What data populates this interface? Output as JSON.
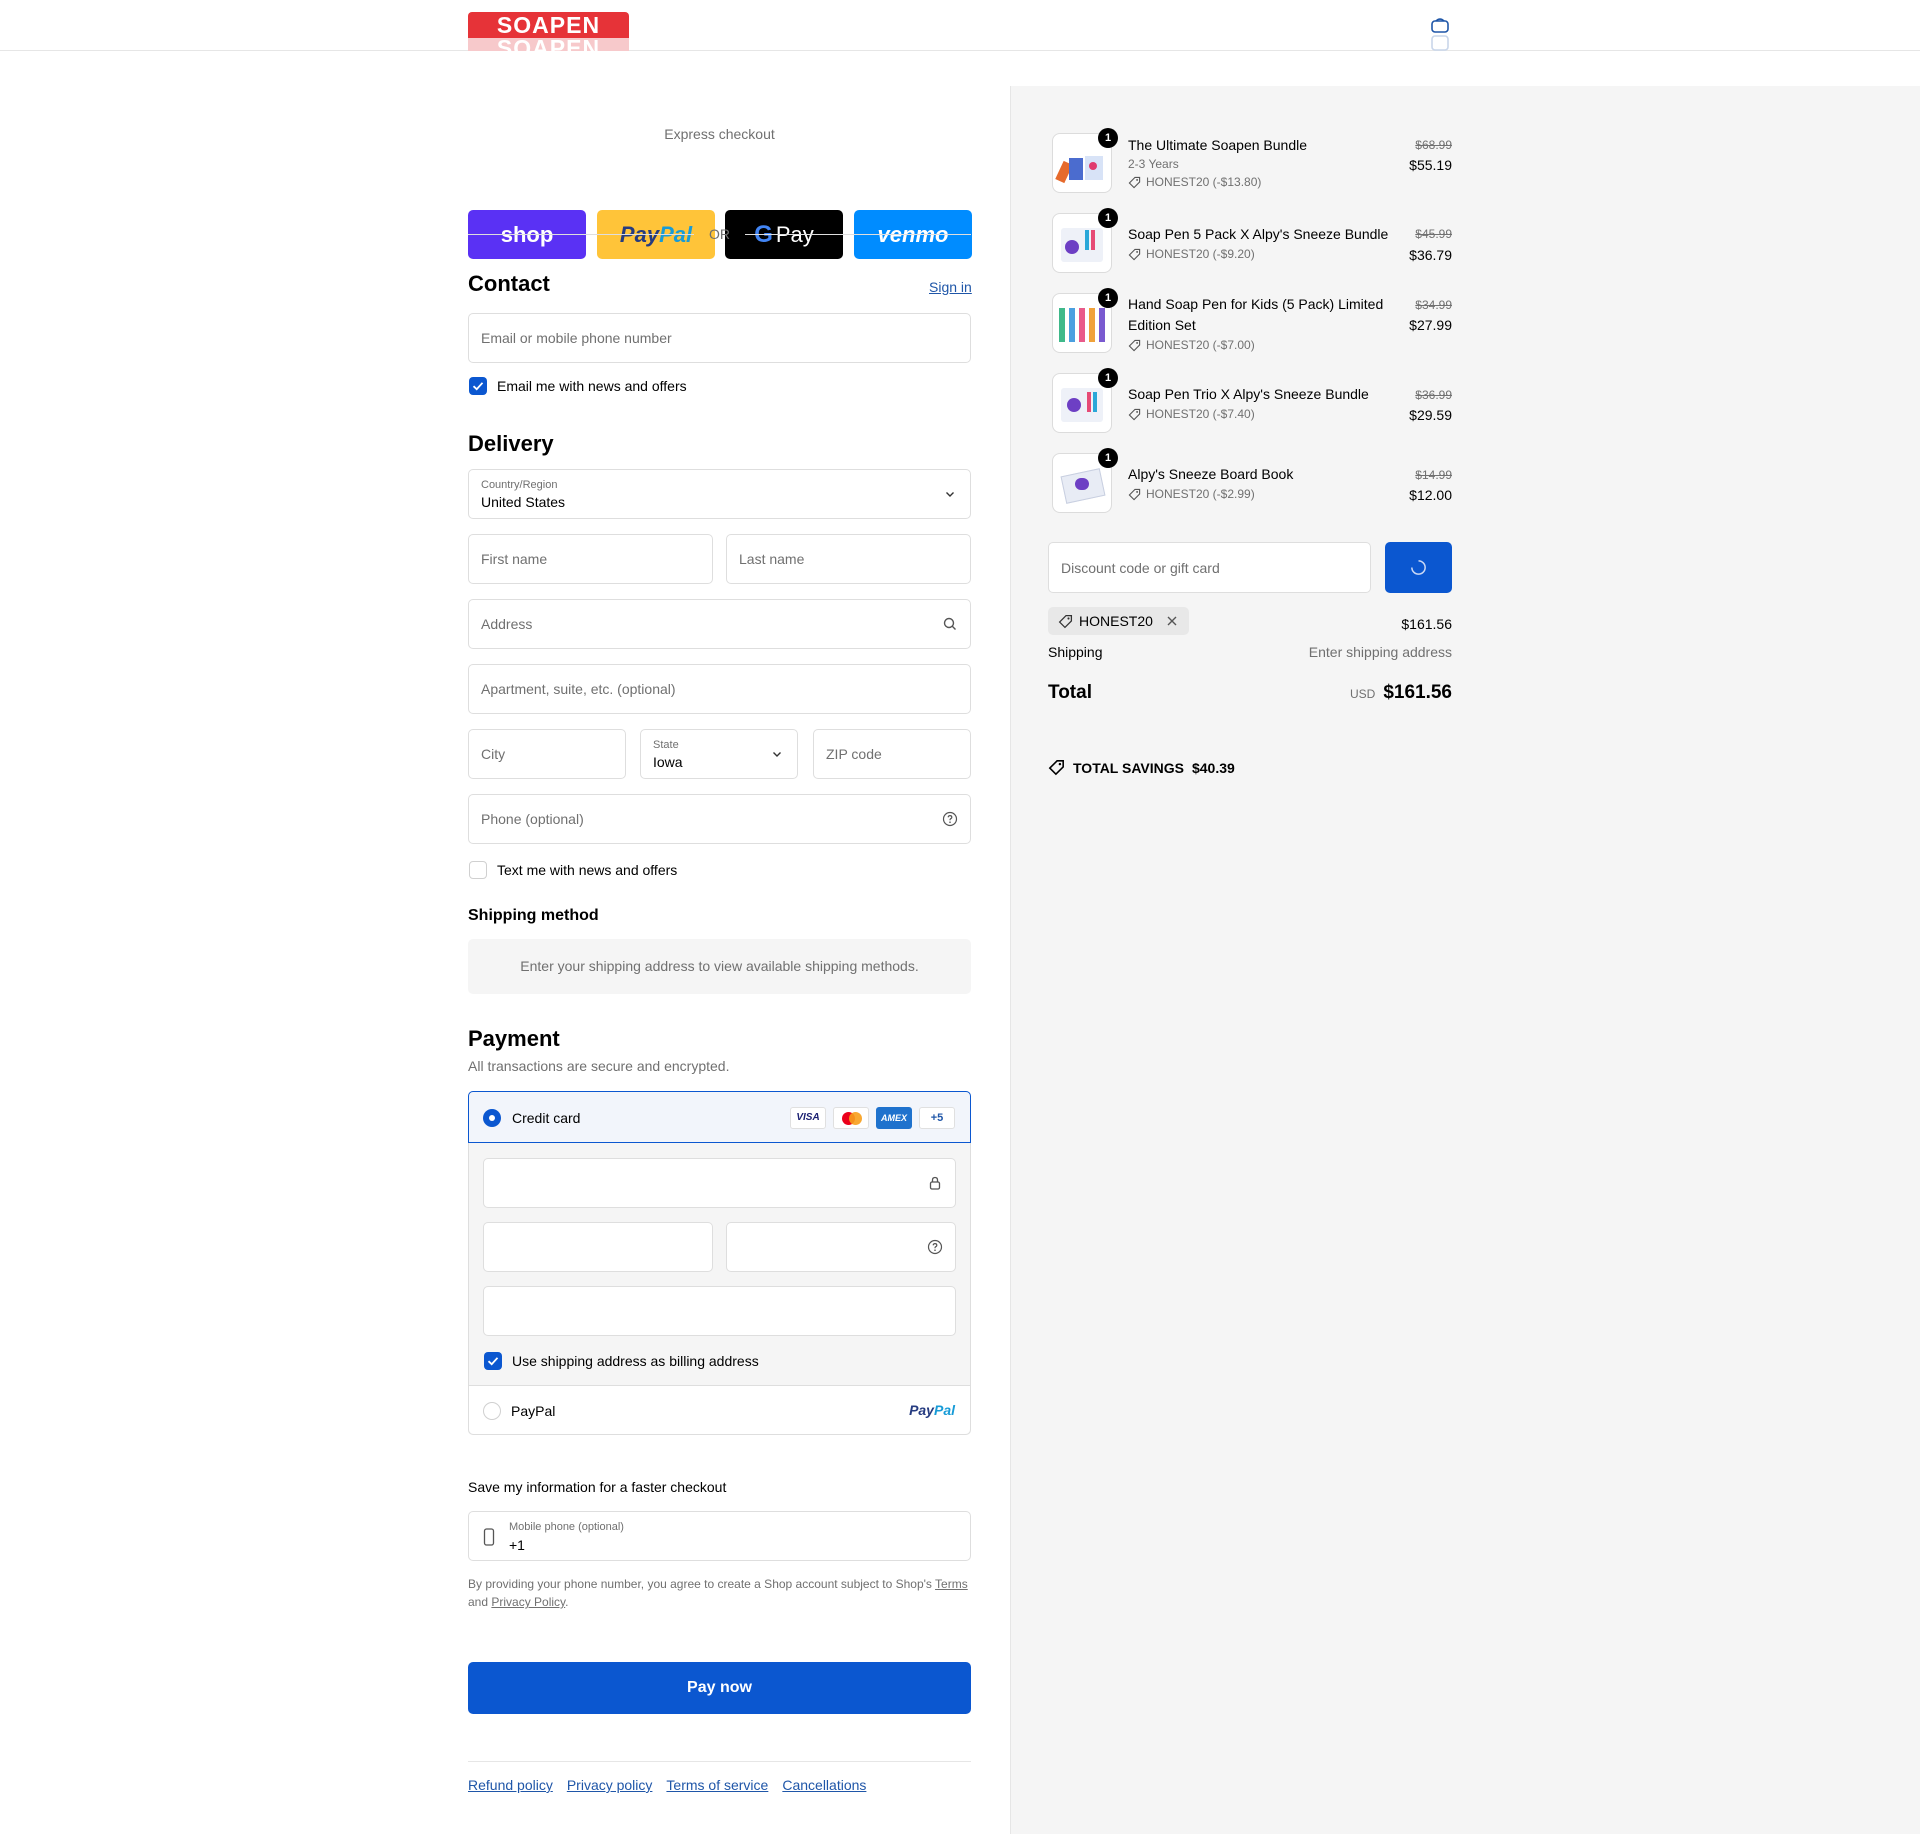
{
  "header": {
    "logo_text": "SOAPEN",
    "cart_icon": "shopping-bag-icon"
  },
  "express": {
    "label": "Express checkout",
    "shop_label": "shop",
    "paypal_label_1": "Pay",
    "paypal_label_2": "Pal",
    "gpay_label": "Pay",
    "venmo_label": "venmo",
    "or_label": "OR"
  },
  "contact": {
    "heading": "Contact",
    "sign_in": "Sign in",
    "email_placeholder": "Email or mobile phone number",
    "news_label": "Email me with news and offers"
  },
  "delivery": {
    "heading": "Delivery",
    "country_label": "Country/Region",
    "country_value": "United States",
    "first_name": "First name",
    "last_name": "Last name",
    "address": "Address",
    "apartment": "Apartment, suite, etc. (optional)",
    "city": "City",
    "state_label": "State",
    "state_value": "Iowa",
    "zip": "ZIP code",
    "phone": "Phone (optional)",
    "text_label": "Text me with news and offers"
  },
  "shipping": {
    "heading": "Shipping method",
    "note": "Enter your shipping address to view available shipping methods."
  },
  "payment": {
    "heading": "Payment",
    "subtitle": "All transactions are secure and encrypted.",
    "credit_card": "Credit card",
    "card_visa": "VISA",
    "card_amex": "AMEX",
    "card_more": "+5",
    "billing_label": "Use shipping address as billing address",
    "paypal_option": "PayPal",
    "paypal_logo_1": "Pay",
    "paypal_logo_2": "Pal"
  },
  "save_info": {
    "heading": "Save my information for a faster checkout",
    "mobile_label": "Mobile phone (optional)",
    "mobile_value": "+1",
    "legal_text": "By providing your phone number, you agree to create a Shop account subject to Shop's",
    "terms": "Terms",
    "and": "and",
    "privacy": "Privacy Policy",
    "period": "."
  },
  "pay_now": "Pay now",
  "footer_links": [
    "Refund policy",
    "Privacy policy",
    "Terms of service",
    "Cancellations"
  ],
  "cart": {
    "items": [
      {
        "qty": "1",
        "name": "The Ultimate Soapen Bundle",
        "variant": "2-3 Years",
        "discount": "HONEST20 (-$13.80)",
        "old_price": "$68.99",
        "price": "$55.19"
      },
      {
        "qty": "1",
        "name": "Soap Pen 5 Pack X Alpy's Sneeze Bundle",
        "variant": "",
        "discount": "HONEST20 (-$9.20)",
        "old_price": "$45.99",
        "price": "$36.79"
      },
      {
        "qty": "1",
        "name": "Hand Soap Pen for Kids (5 Pack) Limited Edition Set",
        "variant": "",
        "discount": "HONEST20 (-$7.00)",
        "old_price": "$34.99",
        "price": "$27.99"
      },
      {
        "qty": "1",
        "name": "Soap Pen Trio X Alpy's Sneeze Bundle",
        "variant": "",
        "discount": "HONEST20 (-$7.40)",
        "old_price": "$36.99",
        "price": "$29.59"
      },
      {
        "qty": "1",
        "name": "Alpy's Sneeze Board Book",
        "variant": "",
        "discount": "HONEST20 (-$2.99)",
        "old_price": "$14.99",
        "price": "$12.00"
      }
    ],
    "discount_placeholder": "Discount code or gift card",
    "applied_code": "HONEST20",
    "subtotal": "$161.56",
    "shipping_label": "Shipping",
    "shipping_value": "Enter shipping address",
    "total_label": "Total",
    "currency": "USD",
    "total": "$161.56",
    "savings_label": "TOTAL SAVINGS",
    "savings_value": "$40.39"
  },
  "colors": {
    "accent": "#0b57d0",
    "shop": "#5a31f4",
    "paypal": "#ffc439",
    "venmo": "#008cff",
    "brand_red": "#e63338"
  }
}
